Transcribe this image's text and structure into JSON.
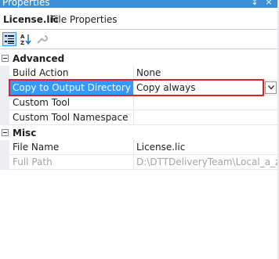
{
  "window": {
    "title": "Properties",
    "pin_glyph": "↕",
    "close_glyph": "×"
  },
  "object_selector": {
    "name": "License.lic",
    "type": "File Properties"
  },
  "toolbar": {
    "categorized_icon": "categorized-view-icon",
    "alphabetical_icon": "alphabetical-sort-icon",
    "property_pages_icon": "wrench-icon"
  },
  "categories": [
    {
      "label": "Advanced",
      "properties": [
        {
          "name": "Build Action",
          "value": "None"
        },
        {
          "name": "Copy to Output Directory",
          "value": "Copy always"
        },
        {
          "name": "Custom Tool",
          "value": ""
        },
        {
          "name": "Custom Tool Namespace",
          "value": ""
        }
      ]
    },
    {
      "label": "Misc",
      "properties": [
        {
          "name": "File Name",
          "value": "License.lic"
        },
        {
          "name": "Full Path",
          "value": "D:\\DTTDeliveryTeam\\Local_a_zhar"
        }
      ]
    }
  ],
  "colors": {
    "title_bar": "#3a8fd6",
    "selection": "#3399ff",
    "highlight_border": "#e0202b",
    "disabled_text": "#a2a4a5"
  }
}
